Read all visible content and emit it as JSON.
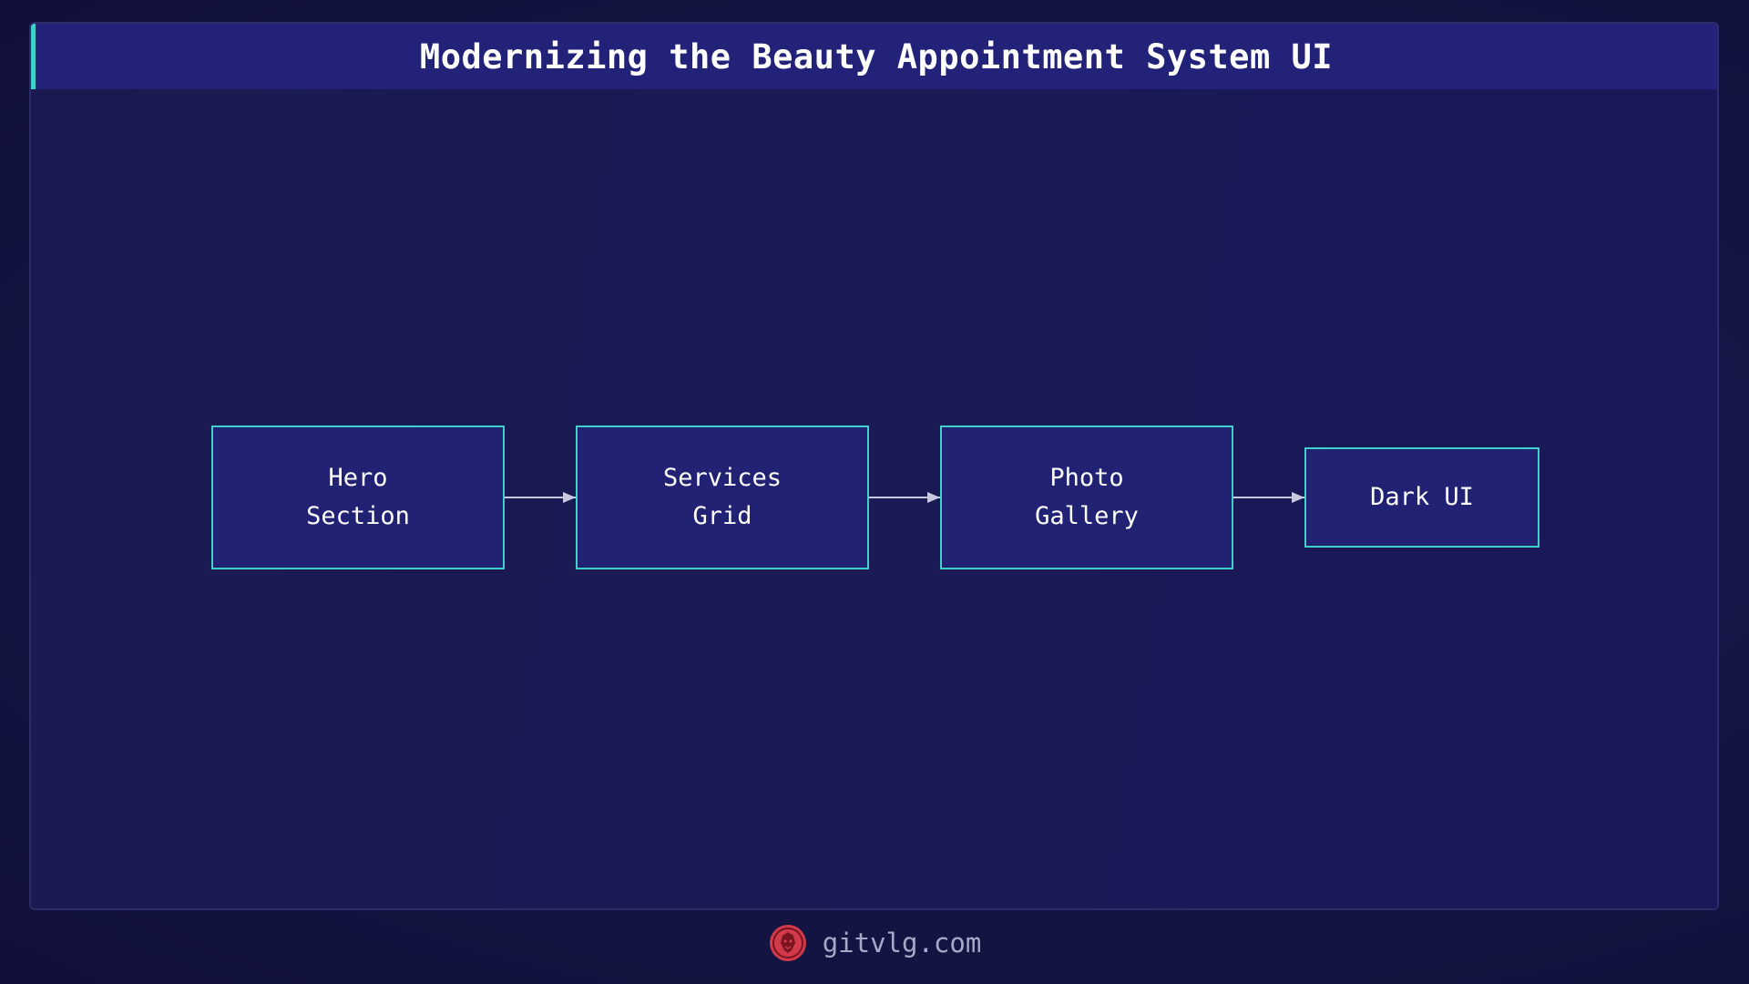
{
  "header": {
    "title": "Modernizing the Beauty Appointment System UI"
  },
  "diagram": {
    "nodes": [
      {
        "lines": [
          "Hero",
          "Section"
        ]
      },
      {
        "lines": [
          "Services",
          "Grid"
        ]
      },
      {
        "lines": [
          "Photo",
          "Gallery"
        ]
      },
      {
        "lines": [
          "Dark UI"
        ]
      }
    ],
    "edges": [
      {
        "from": 0,
        "to": 1
      },
      {
        "from": 1,
        "to": 2
      },
      {
        "from": 2,
        "to": 3
      }
    ]
  },
  "footer": {
    "site": "gitvlg.com",
    "logo_icon": "lion-logo-icon"
  },
  "colors": {
    "background": "#12123a",
    "title_bar": "#222278",
    "accent": "#3fd0c9",
    "node_fill": "#222274",
    "arrow": "#c8c8e0",
    "logo": "#d03a4a"
  }
}
